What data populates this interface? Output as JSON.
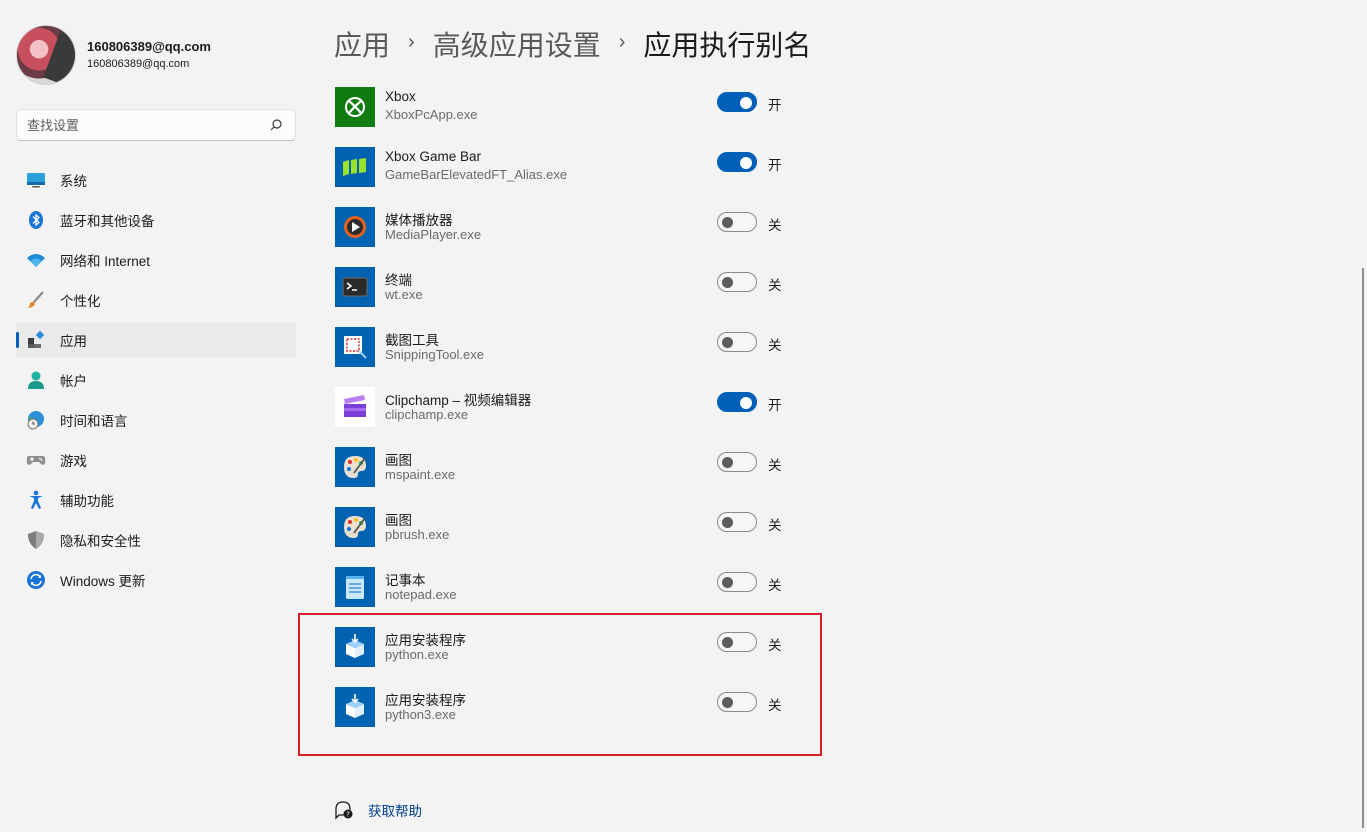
{
  "profile": {
    "name": "160806389@qq.com",
    "email": "160806389@qq.com"
  },
  "search": {
    "placeholder": "查找设置"
  },
  "nav": {
    "items": [
      {
        "label": "系统",
        "icon": "monitor-icon"
      },
      {
        "label": "蓝牙和其他设备",
        "icon": "bluetooth-icon"
      },
      {
        "label": "网络和 Internet",
        "icon": "wifi-icon"
      },
      {
        "label": "个性化",
        "icon": "paintbrush-icon"
      },
      {
        "label": "应用",
        "icon": "apps-icon",
        "active": true
      },
      {
        "label": "帐户",
        "icon": "person-icon"
      },
      {
        "label": "时间和语言",
        "icon": "globe-clock-icon"
      },
      {
        "label": "游戏",
        "icon": "gamepad-icon"
      },
      {
        "label": "辅助功能",
        "icon": "accessibility-icon"
      },
      {
        "label": "隐私和安全性",
        "icon": "shield-icon"
      },
      {
        "label": "Windows 更新",
        "icon": "update-icon"
      }
    ]
  },
  "breadcrumb": {
    "level1": "应用",
    "level2": "高级应用设置",
    "current": "应用执行别名",
    "separator": "›"
  },
  "aliases": [
    {
      "name": "Xbox",
      "exe": "XboxPcApp.exe",
      "on": true,
      "state": "开",
      "icon": "xbox-icon"
    },
    {
      "name": "Xbox Game Bar",
      "exe": "GameBarElevatedFT_Alias.exe",
      "on": true,
      "state": "开",
      "icon": "game-bar-icon"
    },
    {
      "name": "媒体播放器",
      "exe": "MediaPlayer.exe",
      "on": false,
      "state": "关",
      "icon": "media-player-icon"
    },
    {
      "name": "终端",
      "exe": "wt.exe",
      "on": false,
      "state": "关",
      "icon": "terminal-icon"
    },
    {
      "name": "截图工具",
      "exe": "SnippingTool.exe",
      "on": false,
      "state": "关",
      "icon": "snipping-tool-icon"
    },
    {
      "name": "Clipchamp – 视频编辑器",
      "exe": "clipchamp.exe",
      "on": true,
      "state": "开",
      "icon": "clipchamp-icon"
    },
    {
      "name": "画图",
      "exe": "mspaint.exe",
      "on": false,
      "state": "关",
      "icon": "paint-icon"
    },
    {
      "name": "画图",
      "exe": "pbrush.exe",
      "on": false,
      "state": "关",
      "icon": "paint-icon"
    },
    {
      "name": "记事本",
      "exe": "notepad.exe",
      "on": false,
      "state": "关",
      "icon": "notepad-icon"
    },
    {
      "name": "应用安装程序",
      "exe": "python.exe",
      "on": false,
      "state": "关",
      "icon": "app-installer-icon"
    },
    {
      "name": "应用安装程序",
      "exe": "python3.exe",
      "on": false,
      "state": "关",
      "icon": "app-installer-icon"
    }
  ],
  "help": {
    "label": "获取帮助"
  },
  "colors": {
    "accent": "#005fb8",
    "highlight_border": "#d6202b",
    "background": "#f3f3f3"
  }
}
